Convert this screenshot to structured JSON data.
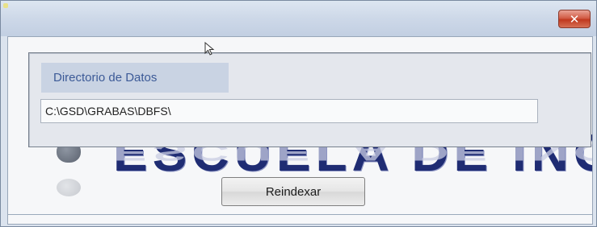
{
  "window": {
    "close_glyph": "✕",
    "close_color": "#c7432b",
    "title_bar_color": "#cdd8e8"
  },
  "banner": {
    "text": "ESCUELA DE INGENIERÍ",
    "text_color": "#1f2c73"
  },
  "panel": {
    "label": "Directorio de Datos",
    "path_value": "C:\\GSD\\GRABAS\\DBFS\\",
    "label_color": "#3c5a97"
  },
  "actions": {
    "reindex_label": "Reindexar"
  },
  "icons": {
    "close": "close-icon",
    "cursor": "mouse-cursor-icon",
    "logo": "school-logo-icon"
  }
}
